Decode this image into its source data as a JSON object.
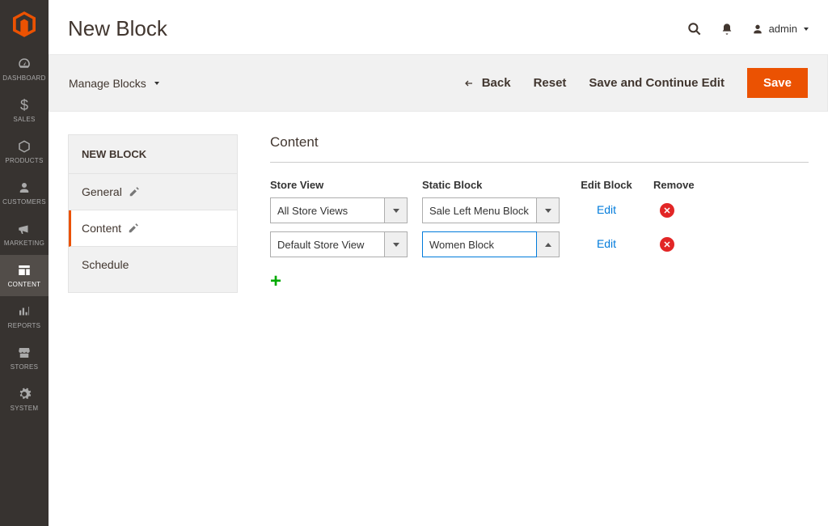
{
  "page_title": "New Block",
  "user": {
    "name": "admin"
  },
  "sidebar": {
    "items": [
      {
        "label": "DASHBOARD"
      },
      {
        "label": "SALES"
      },
      {
        "label": "PRODUCTS"
      },
      {
        "label": "CUSTOMERS"
      },
      {
        "label": "MARKETING"
      },
      {
        "label": "CONTENT"
      },
      {
        "label": "REPORTS"
      },
      {
        "label": "STORES"
      },
      {
        "label": "SYSTEM"
      }
    ]
  },
  "action_bar": {
    "breadcrumb": "Manage Blocks",
    "back": "Back",
    "reset": "Reset",
    "save_continue": "Save and Continue Edit",
    "save": "Save"
  },
  "side_tabs": {
    "header": "NEW BLOCK",
    "items": [
      {
        "label": "General",
        "has_icon": true
      },
      {
        "label": "Content",
        "has_icon": true
      },
      {
        "label": "Schedule",
        "has_icon": false
      }
    ]
  },
  "content": {
    "section_title": "Content",
    "columns": {
      "store_view": "Store View",
      "static_block": "Static Block",
      "edit_block": "Edit Block",
      "remove": "Remove"
    },
    "rows": [
      {
        "store_view": "All Store Views",
        "static_block": "Sale Left Menu Block",
        "edit_label": "Edit",
        "caret": "down"
      },
      {
        "store_view": "Default Store View",
        "static_block": "Women Block",
        "edit_label": "Edit",
        "caret": "up",
        "focused": true
      }
    ]
  }
}
